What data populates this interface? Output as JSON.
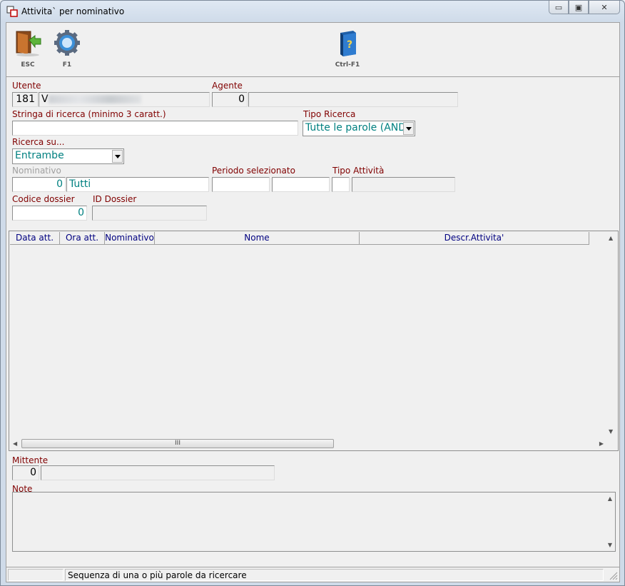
{
  "window": {
    "title": "Attivita` per nominativo",
    "minimize_glyph": "▭",
    "maximize_glyph": "▣",
    "close_glyph": "✕"
  },
  "toolbar": {
    "esc_label": "ESC",
    "f1_label": "F1",
    "ctrlf1_label": "Ctrl-F1"
  },
  "form": {
    "utente_label": "Utente",
    "utente_code": "181",
    "utente_name_initial": "V",
    "agente_label": "Agente",
    "agente_code": "0",
    "agente_name": "",
    "stringa_label": "Stringa di ricerca (minimo 3 caratt.)",
    "stringa_value": "",
    "tipo_ricerca_label": "Tipo Ricerca",
    "tipo_ricerca_value": "Tutte le parole (AND",
    "ricerca_su_label": "Ricerca su...",
    "ricerca_su_value": "Entrambe",
    "nominativo_label": "Nominativo",
    "nominativo_code": "0",
    "nominativo_name": "Tutti",
    "periodo_label": "Periodo selezionato",
    "periodo_from": "",
    "periodo_to": "",
    "tipo_attivita_label": "Tipo Attività",
    "tipo_attivita_code": "",
    "tipo_attivita_desc": "",
    "codice_dossier_label": "Codice dossier",
    "codice_dossier_value": "0",
    "id_dossier_label": "ID Dossier",
    "id_dossier_value": ""
  },
  "grid": {
    "columns": [
      "Data att.",
      "Ora att.",
      "Nominativo",
      "Nome",
      "Descr.Attivita'"
    ],
    "rows": [],
    "thumb_grip": "III"
  },
  "mittente": {
    "label": "Mittente",
    "code": "0",
    "name": ""
  },
  "note": {
    "label": "Note",
    "value": ""
  },
  "statusbar": {
    "panel1": "",
    "message": "Sequenza di una o più parole da ricercare"
  }
}
